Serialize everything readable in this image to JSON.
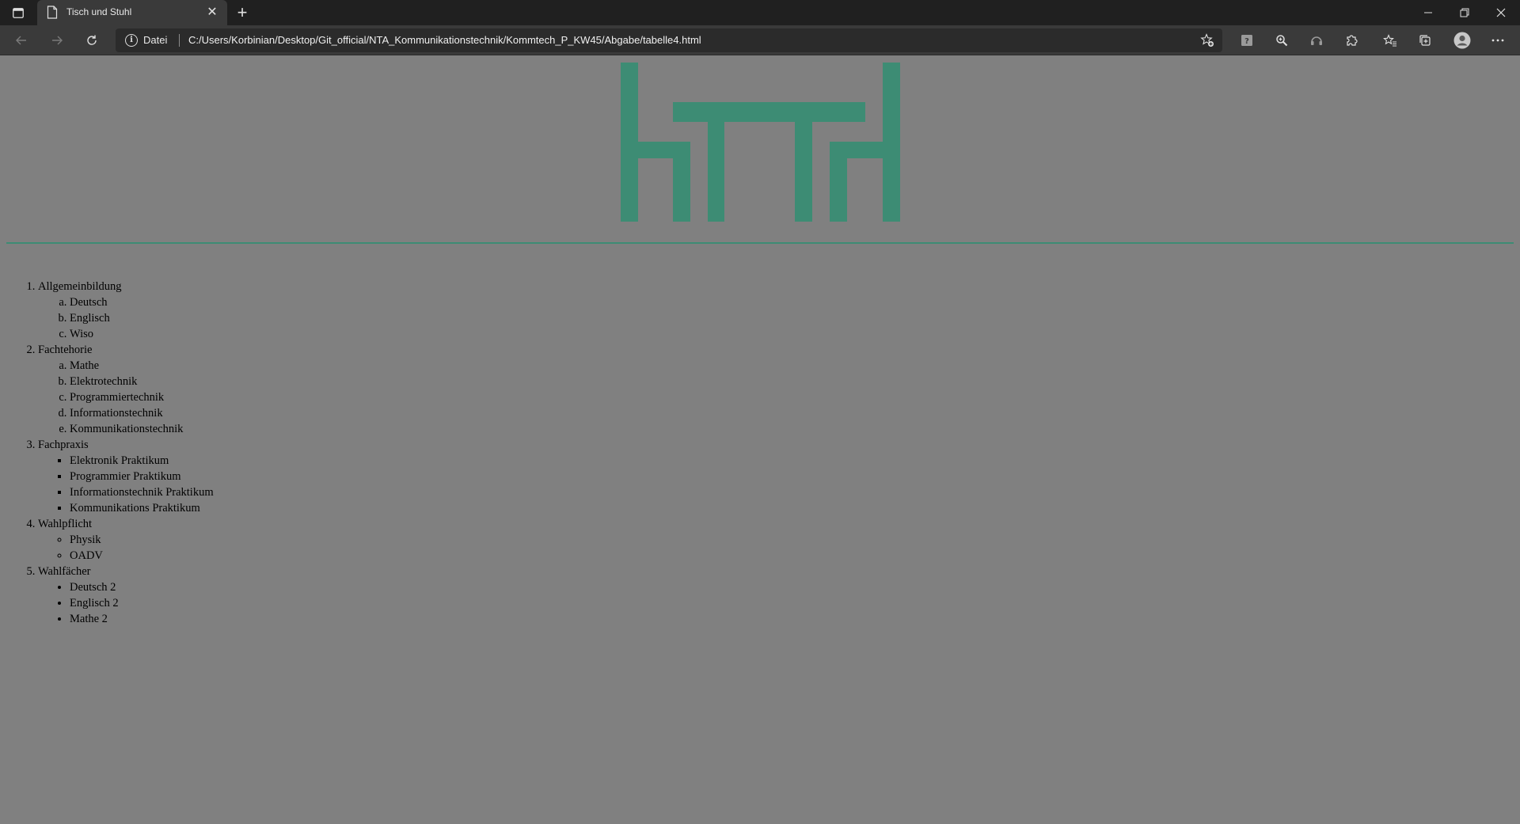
{
  "browser": {
    "tab": {
      "title": "Tisch und Stuhl"
    },
    "new_tab_symbol": "+",
    "tab_close_symbol": "✕",
    "address_bar": {
      "scheme_label": "Datei",
      "url": "C:/Users/Korbinian/Desktop/Git_official/NTA_Kommunikationstechnik/Kommtech_P_KW45/Abgabe/tabelle4.html"
    },
    "window_controls": {
      "minimize": "—",
      "restore": "❐",
      "close": "✕"
    },
    "toolbar_icons": [
      "add-favorite-icon",
      "extension-icon",
      "zoom-icon",
      "read-aloud-icon",
      "extensions-puzzle-icon",
      "favorites-icon",
      "collections-icon",
      "profile-icon",
      "more-icon"
    ]
  },
  "page": {
    "logo_color": "#3d8c74",
    "background_color": "#808080",
    "subjects": [
      {
        "label": "Allgemeinbildung",
        "list_style": "lower-alpha",
        "items": [
          "Deutsch",
          "Englisch",
          "Wiso"
        ]
      },
      {
        "label": "Fachtehorie",
        "list_style": "lower-alpha",
        "items": [
          "Mathe",
          "Elektrotechnik",
          "Programmiertechnik",
          "Informationstechnik",
          "Kommunikationstechnik"
        ]
      },
      {
        "label": "Fachpraxis",
        "list_style": "square",
        "items": [
          "Elektronik Praktikum",
          "Programmier Praktikum",
          "Informationstechnik Praktikum",
          "Kommunikations Praktikum"
        ]
      },
      {
        "label": "Wahlpflicht",
        "list_style": "circle",
        "items": [
          "Physik",
          "OADV"
        ]
      },
      {
        "label": "Wahlfächer",
        "list_style": "disc",
        "items": [
          "Deutsch 2",
          "Englisch 2",
          "Mathe 2"
        ]
      }
    ]
  }
}
